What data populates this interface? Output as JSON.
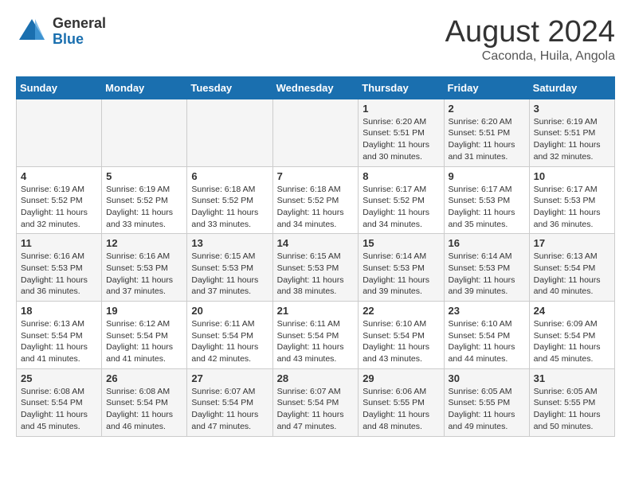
{
  "header": {
    "logo_general": "General",
    "logo_blue": "Blue",
    "month_year": "August 2024",
    "location": "Caconda, Huila, Angola"
  },
  "calendar": {
    "days_of_week": [
      "Sunday",
      "Monday",
      "Tuesday",
      "Wednesday",
      "Thursday",
      "Friday",
      "Saturday"
    ],
    "weeks": [
      [
        {
          "num": "",
          "details": ""
        },
        {
          "num": "",
          "details": ""
        },
        {
          "num": "",
          "details": ""
        },
        {
          "num": "",
          "details": ""
        },
        {
          "num": "1",
          "details": "Sunrise: 6:20 AM\nSunset: 5:51 PM\nDaylight: 11 hours\nand 30 minutes."
        },
        {
          "num": "2",
          "details": "Sunrise: 6:20 AM\nSunset: 5:51 PM\nDaylight: 11 hours\nand 31 minutes."
        },
        {
          "num": "3",
          "details": "Sunrise: 6:19 AM\nSunset: 5:51 PM\nDaylight: 11 hours\nand 32 minutes."
        }
      ],
      [
        {
          "num": "4",
          "details": "Sunrise: 6:19 AM\nSunset: 5:52 PM\nDaylight: 11 hours\nand 32 minutes."
        },
        {
          "num": "5",
          "details": "Sunrise: 6:19 AM\nSunset: 5:52 PM\nDaylight: 11 hours\nand 33 minutes."
        },
        {
          "num": "6",
          "details": "Sunrise: 6:18 AM\nSunset: 5:52 PM\nDaylight: 11 hours\nand 33 minutes."
        },
        {
          "num": "7",
          "details": "Sunrise: 6:18 AM\nSunset: 5:52 PM\nDaylight: 11 hours\nand 34 minutes."
        },
        {
          "num": "8",
          "details": "Sunrise: 6:17 AM\nSunset: 5:52 PM\nDaylight: 11 hours\nand 34 minutes."
        },
        {
          "num": "9",
          "details": "Sunrise: 6:17 AM\nSunset: 5:53 PM\nDaylight: 11 hours\nand 35 minutes."
        },
        {
          "num": "10",
          "details": "Sunrise: 6:17 AM\nSunset: 5:53 PM\nDaylight: 11 hours\nand 36 minutes."
        }
      ],
      [
        {
          "num": "11",
          "details": "Sunrise: 6:16 AM\nSunset: 5:53 PM\nDaylight: 11 hours\nand 36 minutes."
        },
        {
          "num": "12",
          "details": "Sunrise: 6:16 AM\nSunset: 5:53 PM\nDaylight: 11 hours\nand 37 minutes."
        },
        {
          "num": "13",
          "details": "Sunrise: 6:15 AM\nSunset: 5:53 PM\nDaylight: 11 hours\nand 37 minutes."
        },
        {
          "num": "14",
          "details": "Sunrise: 6:15 AM\nSunset: 5:53 PM\nDaylight: 11 hours\nand 38 minutes."
        },
        {
          "num": "15",
          "details": "Sunrise: 6:14 AM\nSunset: 5:53 PM\nDaylight: 11 hours\nand 39 minutes."
        },
        {
          "num": "16",
          "details": "Sunrise: 6:14 AM\nSunset: 5:53 PM\nDaylight: 11 hours\nand 39 minutes."
        },
        {
          "num": "17",
          "details": "Sunrise: 6:13 AM\nSunset: 5:54 PM\nDaylight: 11 hours\nand 40 minutes."
        }
      ],
      [
        {
          "num": "18",
          "details": "Sunrise: 6:13 AM\nSunset: 5:54 PM\nDaylight: 11 hours\nand 41 minutes."
        },
        {
          "num": "19",
          "details": "Sunrise: 6:12 AM\nSunset: 5:54 PM\nDaylight: 11 hours\nand 41 minutes."
        },
        {
          "num": "20",
          "details": "Sunrise: 6:11 AM\nSunset: 5:54 PM\nDaylight: 11 hours\nand 42 minutes."
        },
        {
          "num": "21",
          "details": "Sunrise: 6:11 AM\nSunset: 5:54 PM\nDaylight: 11 hours\nand 43 minutes."
        },
        {
          "num": "22",
          "details": "Sunrise: 6:10 AM\nSunset: 5:54 PM\nDaylight: 11 hours\nand 43 minutes."
        },
        {
          "num": "23",
          "details": "Sunrise: 6:10 AM\nSunset: 5:54 PM\nDaylight: 11 hours\nand 44 minutes."
        },
        {
          "num": "24",
          "details": "Sunrise: 6:09 AM\nSunset: 5:54 PM\nDaylight: 11 hours\nand 45 minutes."
        }
      ],
      [
        {
          "num": "25",
          "details": "Sunrise: 6:08 AM\nSunset: 5:54 PM\nDaylight: 11 hours\nand 45 minutes."
        },
        {
          "num": "26",
          "details": "Sunrise: 6:08 AM\nSunset: 5:54 PM\nDaylight: 11 hours\nand 46 minutes."
        },
        {
          "num": "27",
          "details": "Sunrise: 6:07 AM\nSunset: 5:54 PM\nDaylight: 11 hours\nand 47 minutes."
        },
        {
          "num": "28",
          "details": "Sunrise: 6:07 AM\nSunset: 5:54 PM\nDaylight: 11 hours\nand 47 minutes."
        },
        {
          "num": "29",
          "details": "Sunrise: 6:06 AM\nSunset: 5:55 PM\nDaylight: 11 hours\nand 48 minutes."
        },
        {
          "num": "30",
          "details": "Sunrise: 6:05 AM\nSunset: 5:55 PM\nDaylight: 11 hours\nand 49 minutes."
        },
        {
          "num": "31",
          "details": "Sunrise: 6:05 AM\nSunset: 5:55 PM\nDaylight: 11 hours\nand 50 minutes."
        }
      ]
    ]
  }
}
